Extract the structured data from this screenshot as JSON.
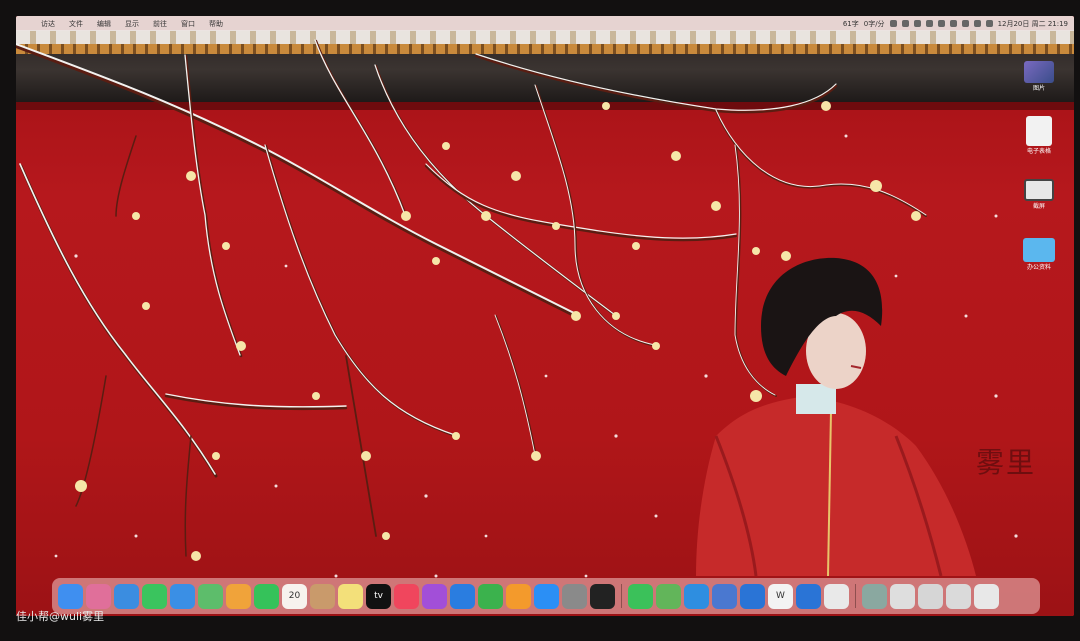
{
  "menubar": {
    "apple": "",
    "items": [
      "访达",
      "文件",
      "编辑",
      "显示",
      "前往",
      "窗口",
      "帮助"
    ],
    "status_left": "61字",
    "status_right": "0字/分",
    "datetime": "12月20日 周二 21:19"
  },
  "desktop_icons": [
    {
      "label": "图片",
      "icon": "picture-icon"
    },
    {
      "label": "电子表格",
      "icon": "document-icon"
    },
    {
      "label": "截屏",
      "icon": "screenshot-icon"
    },
    {
      "label": "办公资料",
      "icon": "folder-icon"
    }
  ],
  "signature": "雾里",
  "dock": {
    "apps": [
      {
        "name": "finder-icon",
        "color": "#3f8ff0"
      },
      {
        "name": "launchpad-icon",
        "color": "#e06f9a"
      },
      {
        "name": "safari-icon",
        "color": "#3b8de0"
      },
      {
        "name": "messages-icon",
        "color": "#3ac45e"
      },
      {
        "name": "mail-icon",
        "color": "#3a8fe5"
      },
      {
        "name": "maps-icon",
        "color": "#5dbd6b"
      },
      {
        "name": "photos-icon",
        "color": "#f0a33a"
      },
      {
        "name": "facetime-icon",
        "color": "#35c25a"
      },
      {
        "name": "calendar-icon",
        "color": "#f7f2ee",
        "text": "20"
      },
      {
        "name": "contacts-icon",
        "color": "#c99a6b"
      },
      {
        "name": "notes-icon",
        "color": "#f3e07a"
      },
      {
        "name": "apple-tv-icon",
        "color": "#111111",
        "text": "tv"
      },
      {
        "name": "music-icon",
        "color": "#f0465d"
      },
      {
        "name": "podcasts-icon",
        "color": "#a24fd8"
      },
      {
        "name": "keynote-icon",
        "color": "#2a7de0"
      },
      {
        "name": "numbers-icon",
        "color": "#3bb24d"
      },
      {
        "name": "pages-icon",
        "color": "#f39a2c"
      },
      {
        "name": "app-store-icon",
        "color": "#2b8ff5"
      },
      {
        "name": "system-preferences-icon",
        "color": "#8a8a8a"
      },
      {
        "name": "activity-monitor-icon",
        "color": "#222222"
      },
      {
        "name": "wechat-icon",
        "color": "#3bc15a"
      },
      {
        "name": "android-icon",
        "color": "#62b55a"
      },
      {
        "name": "app-blue-icon",
        "color": "#2e8ee0"
      },
      {
        "name": "screen-app-icon",
        "color": "#4a78d0"
      },
      {
        "name": "tool-blue-icon",
        "color": "#2a74d6"
      },
      {
        "name": "wps-icon",
        "color": "#f3f3f3",
        "text": "W"
      },
      {
        "name": "tool-blue-2-icon",
        "color": "#2a74d6"
      },
      {
        "name": "chrome-icon",
        "color": "#e9e9e9"
      }
    ],
    "recent": [
      {
        "name": "recent-thumb-icon",
        "color": "#8aa8a0"
      },
      {
        "name": "recent-doc-icon",
        "color": "#dedede"
      },
      {
        "name": "recent-doc-2-icon",
        "color": "#d6d6d6"
      },
      {
        "name": "recent-doc-3-icon",
        "color": "#dadada"
      },
      {
        "name": "trash-icon",
        "color": "#e8e8e8"
      }
    ]
  },
  "credit": "佳小帮@wuli雾里"
}
